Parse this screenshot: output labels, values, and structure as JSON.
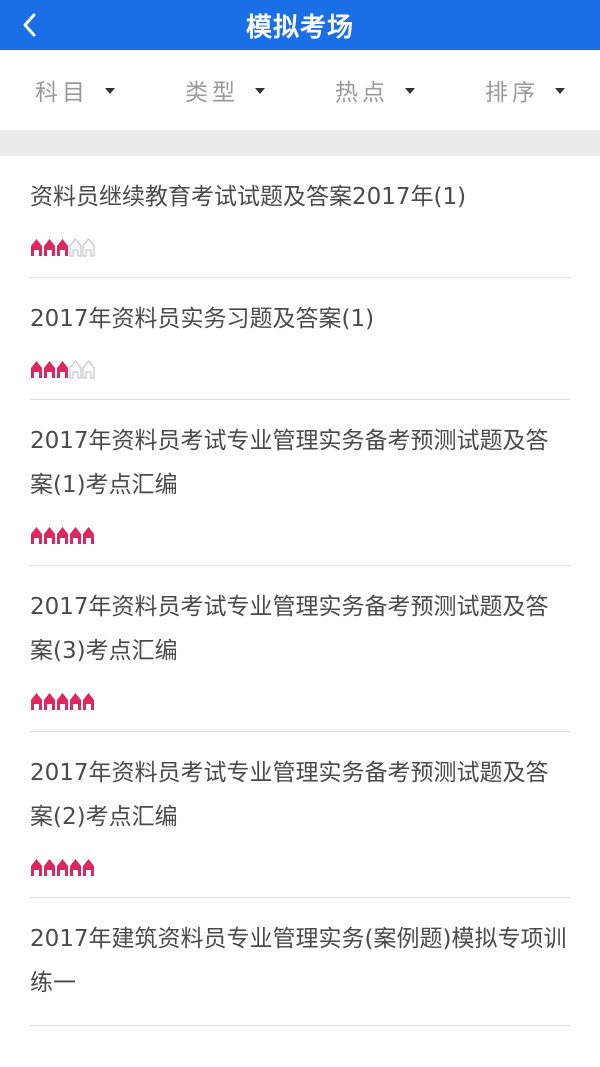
{
  "header": {
    "title": "模拟考场",
    "back_icon": "chevron-left-icon"
  },
  "filters": [
    {
      "label": "科目",
      "icon": "caret-down-icon"
    },
    {
      "label": "类型",
      "icon": "caret-down-icon"
    },
    {
      "label": "热点",
      "icon": "caret-down-icon"
    },
    {
      "label": "排序",
      "icon": "caret-down-icon"
    }
  ],
  "colors": {
    "accent": "#1a6ee6",
    "star_filled": "#e0265f",
    "star_empty": "#c8c8c8"
  },
  "exams": [
    {
      "title": "资料员继续教育考试试题及答案2017年(1)",
      "rating": 3,
      "max_rating": 5
    },
    {
      "title": "2017年资料员实务习题及答案(1)",
      "rating": 3,
      "max_rating": 5
    },
    {
      "title": "2017年资料员考试专业管理实务备考预测试题及答案(1)考点汇编",
      "rating": 5,
      "max_rating": 5
    },
    {
      "title": "2017年资料员考试专业管理实务备考预测试题及答案(3)考点汇编",
      "rating": 5,
      "max_rating": 5
    },
    {
      "title": "2017年资料员考试专业管理实务备考预测试题及答案(2)考点汇编",
      "rating": 5,
      "max_rating": 5
    },
    {
      "title": "2017年建筑资料员专业管理实务(案例题)模拟专项训练一",
      "rating": null,
      "max_rating": 5
    }
  ]
}
